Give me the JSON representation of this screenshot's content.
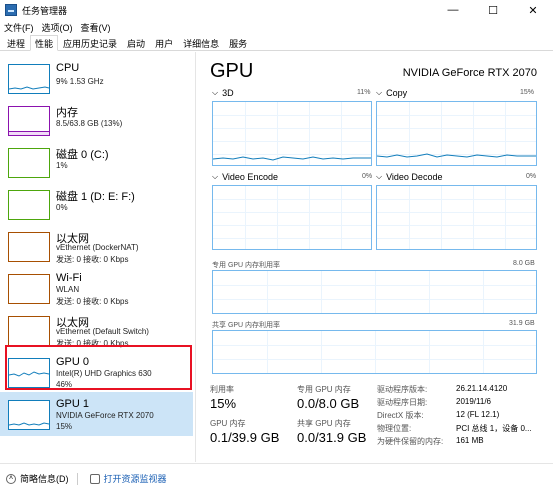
{
  "window": {
    "title": "任务管理器",
    "minimize_glyph": "—",
    "maximize_glyph": "☐",
    "close_glyph": "✕"
  },
  "menu": [
    "文件(F)",
    "选项(O)",
    "查看(V)"
  ],
  "tabs": [
    {
      "label": "进程",
      "active": false
    },
    {
      "label": "性能",
      "active": true
    },
    {
      "label": "应用历史记录",
      "active": false
    },
    {
      "label": "启动",
      "active": false
    },
    {
      "label": "用户",
      "active": false
    },
    {
      "label": "详细信息",
      "active": false
    },
    {
      "label": "服务",
      "active": false
    }
  ],
  "sidebar": {
    "items": [
      {
        "name": "CPU",
        "line1": "9%  1.53 GHz",
        "line2": "",
        "color": "#117dbb"
      },
      {
        "name": "内存",
        "line1": "8.5/63.8 GB (13%)",
        "line2": "",
        "color": "#8b12ae"
      },
      {
        "name": "磁盘 0 (C:)",
        "line1": "1%",
        "line2": "",
        "color": "#4da60c"
      },
      {
        "name": "磁盘 1 (D: E: F:)",
        "line1": "0%",
        "line2": "",
        "color": "#4da60c"
      },
      {
        "name": "以太网",
        "line1": "vEthernet (DockerNAT)",
        "line2": "发送: 0 接收: 0 Kbps",
        "color": "#a74f01"
      },
      {
        "name": "Wi-Fi",
        "line1": "WLAN",
        "line2": "发送: 0 接收: 0 Kbps",
        "color": "#a74f01"
      },
      {
        "name": "以太网",
        "line1": "vEthernet (Default Switch)",
        "line2": "发送: 0 接收: 0 Kbps",
        "color": "#a74f01"
      },
      {
        "name": "GPU 0",
        "line1": "Intel(R) UHD Graphics 630",
        "line2": "46%",
        "color": "#117dbb"
      },
      {
        "name": "GPU 1",
        "line1": "NVIDIA GeForce RTX 2070",
        "line2": "15%",
        "color": "#117dbb"
      }
    ]
  },
  "main": {
    "title": "GPU",
    "device_name": "NVIDIA GeForce RTX 2070",
    "graphs": [
      {
        "label": "3D",
        "pct": "11%",
        "chevron": "⌵"
      },
      {
        "label": "Copy",
        "pct": "15%",
        "chevron": "⌵"
      },
      {
        "label": "Video Encode",
        "pct": "0%",
        "chevron": "⌵"
      },
      {
        "label": "Video Decode",
        "pct": "0%",
        "chevron": "⌵"
      }
    ],
    "dedicated_mem": {
      "label": "专用 GPU 内存利用率",
      "max": "8.0 GB"
    },
    "shared_mem": {
      "label": "共享 GPU 内存利用率",
      "max": "31.9 GB"
    },
    "stats": {
      "utilization_label": "利用率",
      "utilization_value": "15%",
      "dedicated_label": "专用 GPU 内存",
      "dedicated_value": "0.0/8.0 GB",
      "gpu_mem_label": "GPU 内存",
      "gpu_mem_value": "0.1/39.9 GB",
      "shared_label": "共享 GPU 内存",
      "shared_value": "0.0/31.9 GB"
    },
    "details": [
      {
        "key": "驱动程序版本:",
        "value": "26.21.14.4120"
      },
      {
        "key": "驱动程序日期:",
        "value": "2019/11/6"
      },
      {
        "key": "DirectX 版本:",
        "value": "12 (FL 12.1)"
      },
      {
        "key": "物理位置:",
        "value": "PCI 总线 1，设备 0..."
      },
      {
        "key": "为硬件保留的内存:",
        "value": "161 MB"
      }
    ]
  },
  "footer": {
    "collapse_label": "简略信息(D)",
    "monitor_label": "打开资源监视器"
  }
}
